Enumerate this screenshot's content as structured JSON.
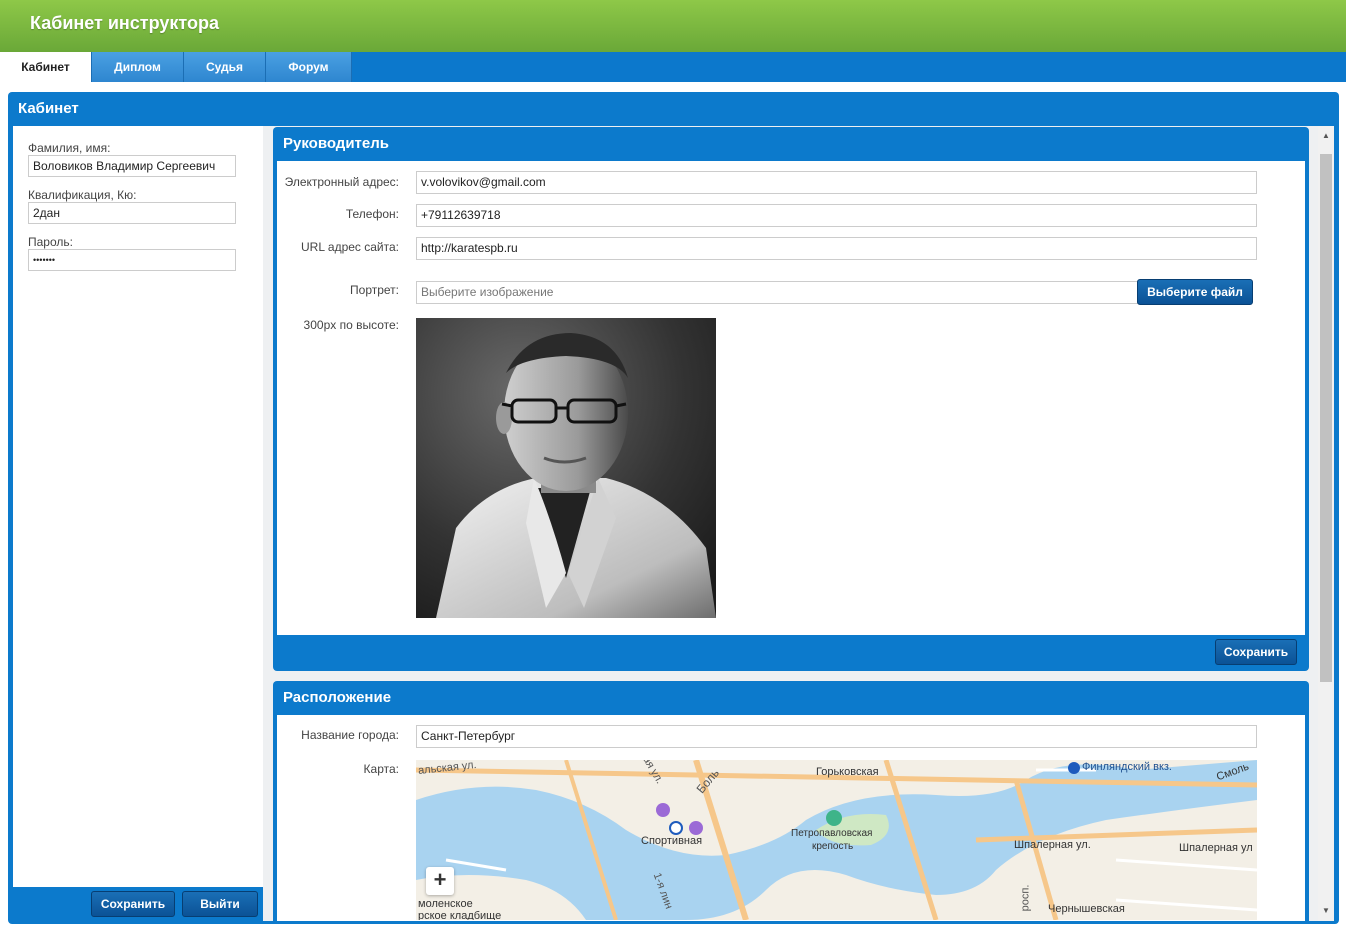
{
  "header": {
    "title": "Кабинет инструктора"
  },
  "tabs": [
    {
      "label": "Кабинет"
    },
    {
      "label": "Диплом"
    },
    {
      "label": "Судья"
    },
    {
      "label": "Форум"
    }
  ],
  "cabinet": {
    "title": "Кабинет",
    "fields": {
      "name_label": "Фамилия, имя:",
      "name_value": "Воловиков Владимир Сергеевич",
      "qual_label": "Квалификация, Кю:",
      "qual_value": "2дан",
      "password_label": "Пароль:",
      "password_value": "•••••••"
    },
    "save_label": "Сохранить",
    "logout_label": "Выйти"
  },
  "manager": {
    "title": "Руководитель",
    "email_label": "Электронный адрес:",
    "email_value": "v.volovikov@gmail.com",
    "phone_label": "Телефон:",
    "phone_value": "+79112639718",
    "url_label": "URL адрес сайта:",
    "url_value": "http://karatespb.ru",
    "portrait_label": "Портрет:",
    "portrait_placeholder": "Выберите изображение",
    "choose_file_label": "Выберите файл",
    "height_note": "300px по высоте:",
    "save_label": "Сохранить"
  },
  "location": {
    "title": "Расположение",
    "city_label": "Название города:",
    "city_value": "Санкт-Петербург",
    "map_label": "Карта:",
    "map_labels": {
      "gorkovskaya": "Горьковская",
      "finland_station": "Финляндский вкз.",
      "smolny": "Смоль",
      "sportivnaya": "Спортивная",
      "fortress_1": "Петропавловская",
      "fortress_2": "крепость",
      "shpalernaya_1": "Шпалерная ул.",
      "shpalernaya_2": "Шпалерная ул",
      "chernyshevskaya": "Чернышевская",
      "street_top_left": "альская ул.",
      "street_bol": "Боль",
      "street_ya": "ая ул.",
      "line_1": "1-я лин",
      "smolenskoe_1": "моленское",
      "smolenskoe_2": "рское кладбище",
      "street_vert": "росп."
    }
  },
  "colors": {
    "header_green": "#7ab93f",
    "primary_blue": "#0c7acc",
    "button_blue": "#0b5296"
  }
}
